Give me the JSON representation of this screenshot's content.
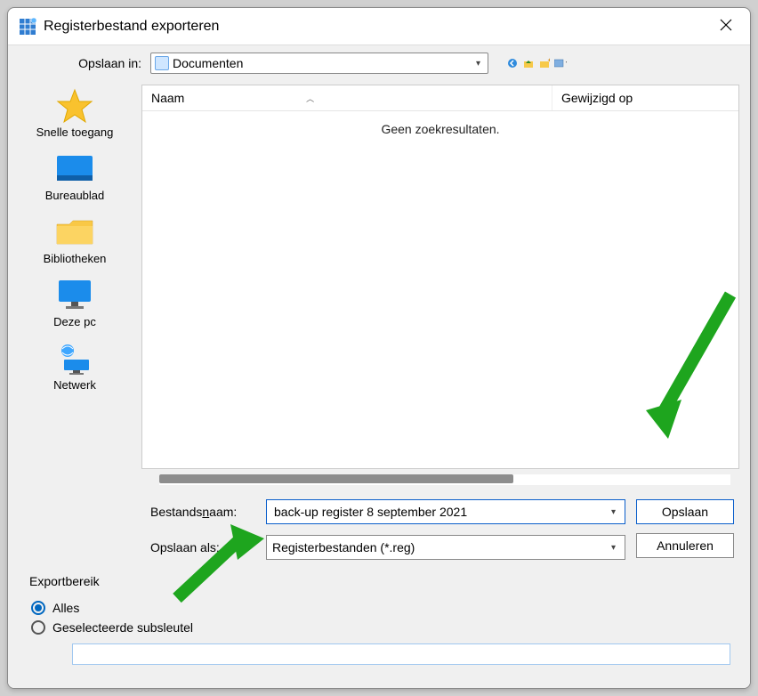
{
  "titlebar": {
    "title": "Registerbestand exporteren"
  },
  "toprow": {
    "label": "Opslaan in:",
    "look_in_value": "Documenten"
  },
  "sidebar": {
    "items": [
      {
        "label": "Snelle toegang"
      },
      {
        "label": "Bureaublad"
      },
      {
        "label": "Bibliotheken"
      },
      {
        "label": "Deze pc"
      },
      {
        "label": "Netwerk"
      }
    ]
  },
  "list": {
    "col_name": "Naam",
    "col_date": "Gewijzigd op",
    "empty": "Geen zoekresultaten."
  },
  "form": {
    "filename_label_prefix": "Bestands",
    "filename_label_underline": "n",
    "filename_label_suffix": "aam:",
    "filename_value": "back-up register 8 september 2021",
    "type_label": "Opslaan als:",
    "type_value": "Registerbestanden (*.reg)",
    "save_label": "Opslaan",
    "cancel_label": "Annuleren"
  },
  "export": {
    "legend": "Exportbereik",
    "option_all": "Alles",
    "option_selected": "Geselecteerde subsleutel",
    "selected": "all"
  }
}
